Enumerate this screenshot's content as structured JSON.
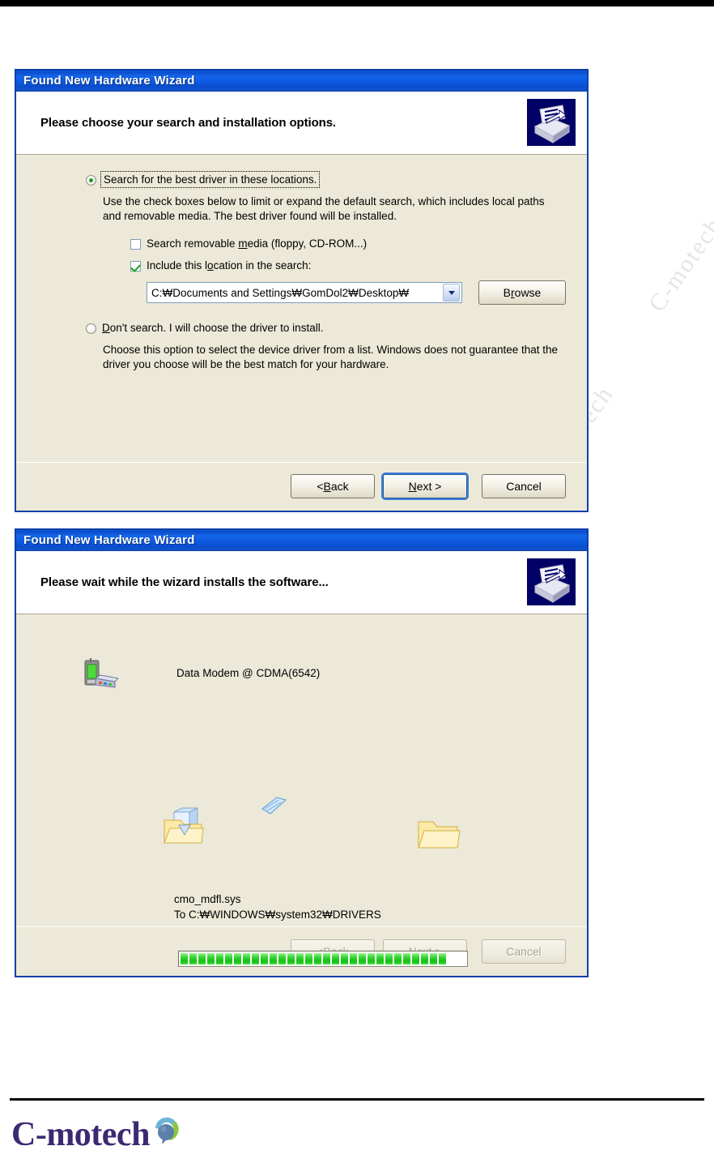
{
  "page": {
    "brand_name": "C-motech",
    "watermark_text": "C-motech"
  },
  "dialog1": {
    "title": "Found New Hardware Wizard",
    "header_title": "Please choose your search and installation options.",
    "wizard_icon": "hardware-wizard-icon",
    "option_search": {
      "label": "Search for the best driver in these locations.",
      "checked": true,
      "focused": true,
      "description": "Use the check boxes below to limit or expand the default search, which includes local paths and removable media. The best driver found will be installed."
    },
    "checkbox_removable": {
      "label_before": "Search removable ",
      "label_mnemonic": "m",
      "label_after": "edia (floppy, CD-ROM...)",
      "checked": false
    },
    "checkbox_location": {
      "label_before": "Include this l",
      "label_mnemonic": "o",
      "label_after": "cation in the search:",
      "checked": true
    },
    "path_combo": {
      "value": "C:₩Documents and Settings₩GomDol2₩Desktop₩",
      "dropdown_icon": "chevron-down-icon"
    },
    "browse_button": {
      "label_before": "B",
      "label_mnemonic": "r",
      "label_after": "owse"
    },
    "option_dont_search": {
      "label_mnemonic": "D",
      "label_after": "on't search. I will choose the driver to install.",
      "checked": false,
      "description": "Choose this option to select the device driver from a list.  Windows does not guarantee that the driver you choose will be the best match for your hardware."
    },
    "buttons": {
      "back": {
        "prefix": "< ",
        "mnemonic": "B",
        "suffix": "ack",
        "disabled": false,
        "default": false
      },
      "next": {
        "prefix": "",
        "mnemonic": "N",
        "suffix": "ext >",
        "disabled": false,
        "default": true
      },
      "cancel": {
        "label": "Cancel",
        "disabled": false,
        "default": false
      }
    }
  },
  "dialog2": {
    "title": "Found New Hardware Wizard",
    "header_title": "Please wait while the wizard installs the software...",
    "wizard_icon": "hardware-wizard-icon",
    "device_icon": "modem-device-icon",
    "device_label": "Data Modem @ CDMA(6542)",
    "copy_animation": {
      "source_icon": "source-folder-icon",
      "flying_icon": "flying-document-icon",
      "destination_icon": "destination-folder-icon"
    },
    "file_name": "cmo_mdfl.sys",
    "file_destination": "To C:₩WINDOWS₩system32₩DRIVERS",
    "progress": {
      "percent": 100,
      "segments": 30
    },
    "buttons": {
      "back": {
        "prefix": "< ",
        "mnemonic": "B",
        "suffix": "ack",
        "disabled": true,
        "default": false
      },
      "next": {
        "prefix": "",
        "mnemonic": "N",
        "suffix": "ext >",
        "disabled": true,
        "default": false
      },
      "cancel": {
        "label": "Cancel",
        "disabled": true,
        "default": false
      }
    }
  }
}
